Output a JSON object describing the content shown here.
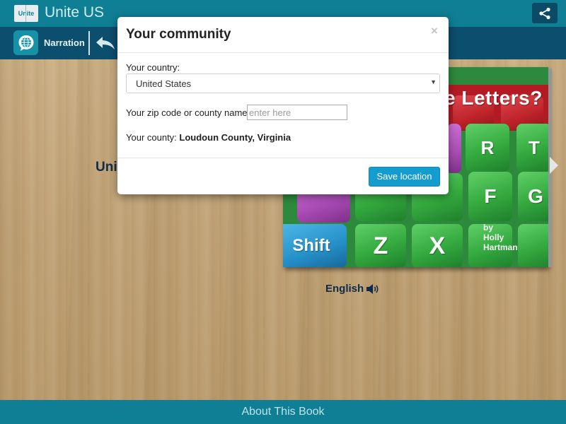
{
  "app": {
    "logo_text": "Unite",
    "title": "Unite US"
  },
  "toolbar": {
    "narration_label": "Narration"
  },
  "book": {
    "heading_visible": "Unit",
    "cover_title_visible": "e Letters?",
    "byline": [
      "by",
      "Holly",
      "Hartman"
    ],
    "keys": [
      "R",
      "T",
      "F",
      "G",
      "Z",
      "X",
      "Shift"
    ],
    "language": "English"
  },
  "footer": {
    "about_label": "About This Book"
  },
  "modal": {
    "title": "Your community",
    "close_glyph": "×",
    "country_label": "Your country:",
    "country_value": "United States",
    "zip_label": "Your zip code or county name:",
    "zip_placeholder": "enter here",
    "county_label": "Your county:",
    "county_value": "Loudoun County, Virginia",
    "save_label": "Save location"
  },
  "colors": {
    "primary": "#0f7f95",
    "secondary": "#0c4e6e",
    "save_button": "#159ccf",
    "heading_text": "#0f2d4a"
  }
}
